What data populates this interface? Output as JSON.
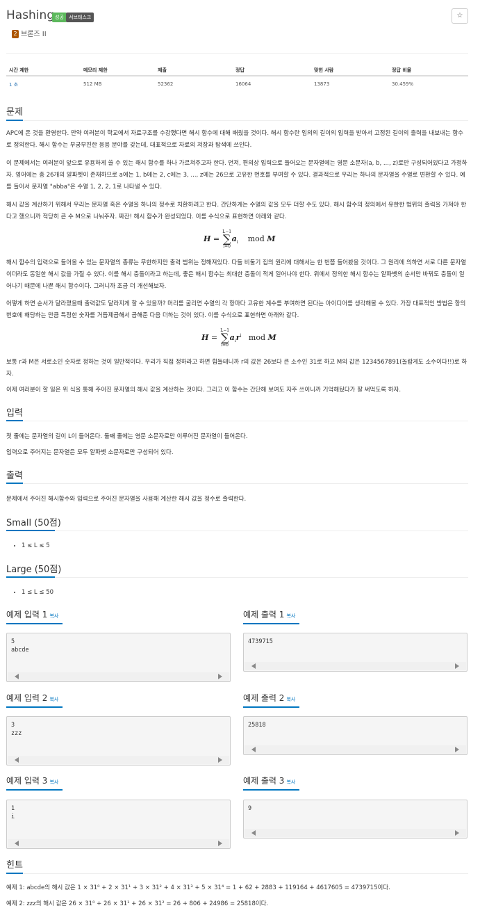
{
  "header": {
    "title": "Hashing",
    "badge_success": "성공",
    "badge_subtask": "서브태스크",
    "star_icon": "☆",
    "tier_icon_label": "2",
    "tier_label": "브론즈 II"
  },
  "stats": {
    "headers": [
      "시간 제한",
      "메모리 제한",
      "제출",
      "정답",
      "맞힌 사람",
      "정답 비율"
    ],
    "values": [
      "1 초",
      "512 MB",
      "52362",
      "16064",
      "13873",
      "30.459%"
    ]
  },
  "problem": {
    "title": "문제",
    "p1": "APC에 온 것을 환영한다. 만약 여러분이 학교에서 자료구조를 수강했다면 해시 함수에 대해 배웠을 것이다. 해시 함수란 임의의 길이의 입력을 받아서 고정된 길이의 출력을 내보내는 함수로 정의한다. 해시 함수는 무궁무진한 응용 분야를 갖는데, 대표적으로 자료의 저장과 탐색에 쓰인다.",
    "p2": "이 문제에서는 여러분이 앞으로 유용하게 쓸 수 있는 해시 함수를 하나 가르쳐주고자 한다. 먼저, 편의상 입력으로 들어오는 문자열에는 영문 소문자(a, b, ..., z)로만 구성되어있다고 가정하자. 영어에는 총 26개의 알파벳이 존재하므로 a에는 1, b에는 2, c에는 3, ..., z에는 26으로 고유한 번호를 부여할 수 있다. 결과적으로 우리는 하나의 문자열을 수열로 변환할 수 있다. 예를 들어서 문자열 \"abba\"은 수열 1, 2, 2, 1로 나타낼 수 있다.",
    "p3": "해시 값을 계산하기 위해서 우리는 문자열 혹은 수열을 하나의 정수로 치환하려고 한다. 간단하게는 수열의 값을 모두 더할 수도 있다. 해시 함수의 정의에서 유한한 범위의 출력을 가져야 한다고 했으니까 적당히 큰 수 M으로 나눠주자. 짜잔! 해시 함수가 완성되었다. 이를 수식으로 표현하면 아래와 같다.",
    "p4": "해시 함수의 입력으로 들어올 수 있는 문자열의 종류는 무한하지만 출력 범위는 정해져있다. 다들 비둘기 집의 원리에 대해서는 한 번쯤 들어봤을 것이다. 그 원리에 의하면 서로 다른 문자열이더라도 동일한 해시 값을 가질 수 있다. 이를 해시 충돌이라고 하는데, 좋은 해시 함수는 최대한 충돌이 적게 일어나야 한다. 위에서 정의한 해시 함수는 알파벳의 순서만 바꿔도 충돌이 일어나기 때문에 나쁜 해시 함수이다. 그러니까 조금 더 개선해보자.",
    "p5": "어떻게 하면 순서가 달라졌을때 출력값도 달라지게 할 수 있을까? 머리를 굴리면 수열의 각 항마다 고유한 계수를 부여하면 된다는 아이디어를 생각해볼 수 있다. 가장 대표적인 방법은 항의 번호에 해당하는 만큼 특정한 숫자를 거듭제곱해서 곱해준 다음 더하는 것이 있다. 이를 수식으로 표현하면 아래와 같다.",
    "p6": "보통 r과 M은 서로소인 숫자로 정하는 것이 일반적이다. 우리가 직접 정하라고 하면 힘들테니까 r의 값은 26보다 큰 소수인 31로 하고 M의 값은 1234567891(놀랍게도 소수이다!!)로 하자.",
    "p7": "이제 여러분이 할 일은 위 식을 통해 주어진 문자열의 해시 값을 계산하는 것이다. 그리고 이 함수는 간단해 보여도 자주 쓰이니까 기억해뒀다가 잘 써먹도록 하자."
  },
  "input": {
    "title": "입력",
    "p1": "첫 줄에는 문자열의 길이 L이 들어온다. 둘째 줄에는 영문 소문자로만 이루어진 문자열이 들어온다.",
    "p2": "입력으로 주어지는 문자열은 모두 알파벳 소문자로만 구성되어 있다."
  },
  "output": {
    "title": "출력",
    "p1": "문제에서 주어진 해시함수와 입력으로 주어진 문자열을 사용해 계산한 해시 값을 정수로 출력한다."
  },
  "small": {
    "title": "Small (50점)",
    "item": "1 ≤ L ≤ 5"
  },
  "large": {
    "title": "Large (50점)",
    "item": "1 ≤ L ≤ 50"
  },
  "samples": {
    "copy_label": "복사",
    "in1_title": "예제 입력 1",
    "in1": "5\nabcde",
    "out1_title": "예제 출력 1",
    "out1": "4739715",
    "in2_title": "예제 입력 2",
    "in2": "3\nzzz",
    "out2_title": "예제 출력 2",
    "out2": "25818",
    "in3_title": "예제 입력 3",
    "in3": "1\ni",
    "out3_title": "예제 출력 3",
    "out3": "9"
  },
  "hint": {
    "title": "힌트",
    "l1": "예제 1: abcde의 해시 값은 1 × 31⁰ + 2 × 31¹ + 3 × 31² + 4 × 31³ + 5 × 31⁴ = 1 + 62 + 2883 + 119164 + 4617605 = 4739715이다.",
    "l2": "예제 2: zzz의 해시 값은 26 × 31⁰ + 26 × 31¹ + 26 × 31² = 26 + 806 + 24986 = 25818이다."
  },
  "formula1": {
    "lhs": "H",
    "upper": "L−1",
    "lower": "i=0",
    "term": "a",
    "sub": "i",
    "mod": "mod",
    "m": "M"
  },
  "formula2": {
    "lhs": "H",
    "upper": "L−1",
    "lower": "i=0",
    "term": "a",
    "sub": "i",
    "r": "r",
    "sup": "i",
    "mod": "mod",
    "m": "M"
  }
}
